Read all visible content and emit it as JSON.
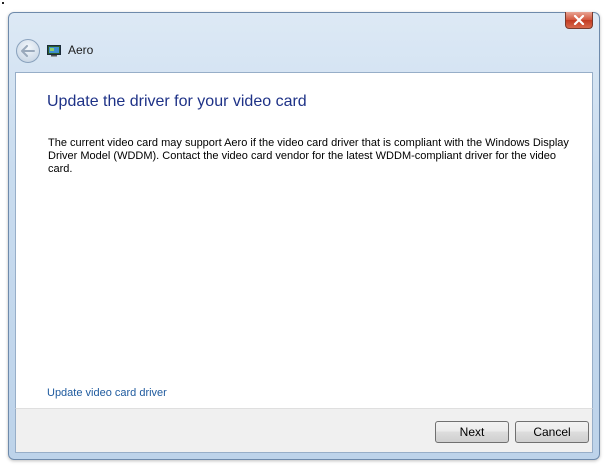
{
  "window": {
    "title": "Aero",
    "close_icon": "close-icon",
    "back_icon": "back-arrow-icon",
    "app_icon": "display-icon"
  },
  "content": {
    "heading": "Update the driver for your video card",
    "body": "The current video card may support Aero if the video card driver that is compliant with the Windows Display Driver Model (WDDM).  Contact the video card vendor for the latest WDDM-compliant driver for the video card.",
    "link": "Update video card driver"
  },
  "footer": {
    "next_label": "Next",
    "cancel_label": "Cancel"
  },
  "colors": {
    "heading": "#1e3287",
    "link": "#1e5a9e",
    "close_button": "#c23a20"
  }
}
